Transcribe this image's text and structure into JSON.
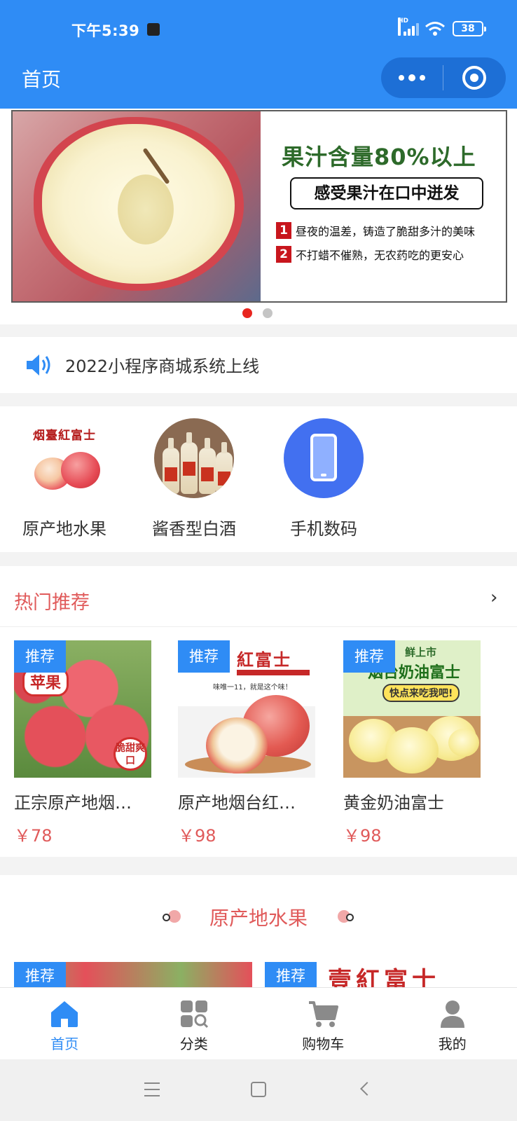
{
  "status_bar": {
    "time": "下午5:39",
    "network": "HD",
    "battery": "38"
  },
  "header": {
    "title": "首页"
  },
  "banner": {
    "headline": "果汁含量80%以上",
    "box_text": "感受果汁在口中迸发",
    "point1_num": "1",
    "point1_text": "昼夜的温差，铸造了脆甜多汁的美味",
    "point2_num": "2",
    "point2_text": "不打蜡不催熟，无农药吃的更安心",
    "active_index": 0,
    "slide_count": 2
  },
  "notice": {
    "text": "2022小程序商城系统上线"
  },
  "categories": [
    {
      "label": "原产地水果",
      "image_text": "烟臺紅富士"
    },
    {
      "label": "酱香型白酒"
    },
    {
      "label": "手机数码"
    }
  ],
  "hot": {
    "title": "热门推荐",
    "more": "›",
    "products": [
      {
        "tag": "推荐",
        "name": "正宗原产地烟…",
        "price": "￥78",
        "img_badge": "苹果",
        "img_badge2": "脆甜爽口"
      },
      {
        "tag": "推荐",
        "name": "原产地烟台红…",
        "price": "￥98",
        "img_title": "紅富士",
        "img_sub": "味唯一11，就是这个味！"
      },
      {
        "tag": "推荐",
        "name": "黄金奶油富士",
        "price": "￥98",
        "img_top": "鲜上市",
        "img_title": "烟台奶油富士",
        "img_pill": "快点来吃我吧!"
      }
    ]
  },
  "section": {
    "title": "原产地水果",
    "peek_tags": [
      "推荐",
      "推荐"
    ],
    "peek_red_text": "壹紅富士"
  },
  "tabbar": {
    "items": [
      {
        "label": "首页",
        "icon": "home-icon",
        "active": true
      },
      {
        "label": "分类",
        "icon": "category-icon",
        "active": false
      },
      {
        "label": "购物车",
        "icon": "cart-icon",
        "active": false
      },
      {
        "label": "我的",
        "icon": "user-icon",
        "active": false
      }
    ]
  },
  "colors": {
    "primary": "#2f8cf5",
    "accent_red": "#e05a5a",
    "banner_dot_active": "#e8251f"
  }
}
